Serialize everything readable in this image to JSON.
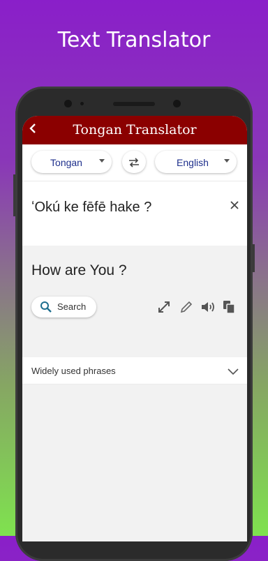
{
  "promo": {
    "headline": "Text Translator"
  },
  "appbar": {
    "title": "Tongan Translator",
    "back_icon": "chevron-left-icon"
  },
  "languages": {
    "source": "Tongan",
    "target": "English",
    "swap_icon": "swap-arrows-icon"
  },
  "input": {
    "text": "ʻOkú ke fēfē hake ?",
    "clear_icon": "close-icon"
  },
  "output": {
    "text": "How are You ?",
    "search_label": "Search",
    "tools": [
      "expand-icon",
      "edit-icon",
      "speaker-icon",
      "copy-icon"
    ]
  },
  "phrases": {
    "label": "Widely used phrases"
  },
  "colors": {
    "brand": "#8b0000",
    "lang_text": "#1e2f8c",
    "search_icon": "#1e6e8e"
  }
}
